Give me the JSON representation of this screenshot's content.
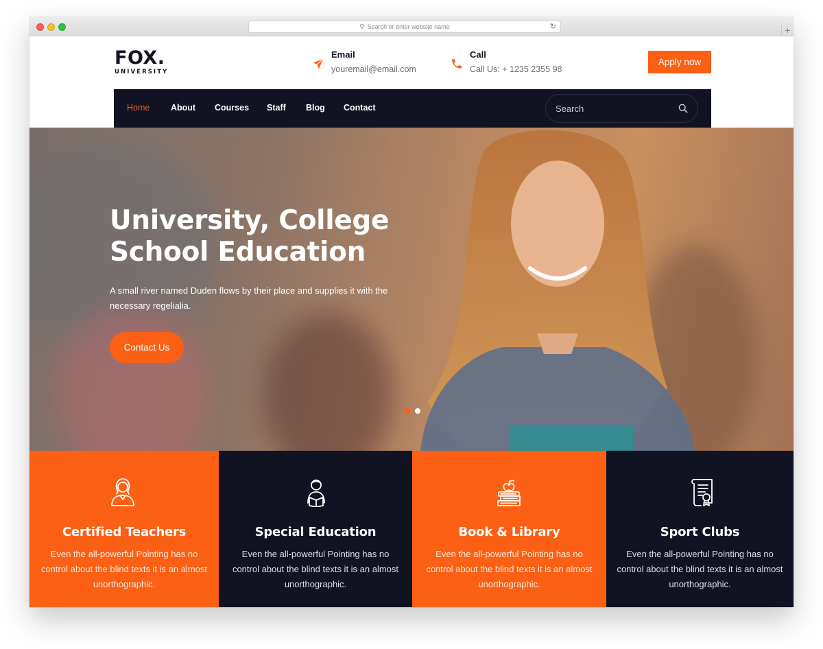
{
  "browser": {
    "address_placeholder": "Search or enter website name"
  },
  "header": {
    "logo_main": "FOX.",
    "logo_sub": "UNIVERSITY",
    "email": {
      "title": "Email",
      "value": "youremail@email.com",
      "icon": "paper-plane-icon"
    },
    "call": {
      "title": "Call",
      "value": "Call Us: + 1235 2355 98",
      "icon": "phone-icon"
    },
    "apply_label": "Apply now"
  },
  "nav": {
    "items": [
      {
        "label": "Home",
        "active": true
      },
      {
        "label": "About",
        "active": false
      },
      {
        "label": "Courses",
        "active": false
      },
      {
        "label": "Staff",
        "active": false
      },
      {
        "label": "Blog",
        "active": false
      },
      {
        "label": "Contact",
        "active": false
      }
    ],
    "search_placeholder": "Search",
    "search_icon": "search-icon"
  },
  "hero": {
    "title_line1": "University, College",
    "title_line2": "School Education",
    "subtitle": "A small river named Duden flows by their place and supplies it with the necessary regelialia.",
    "button_label": "Contact Us",
    "slides": 2,
    "active_slide": 1
  },
  "features": [
    {
      "title": "Certified Teachers",
      "description": "Even the all-powerful Pointing has no control about the blind texts it is an almost unorthographic.",
      "icon": "teacher-icon",
      "theme": "orange"
    },
    {
      "title": "Special Education",
      "description": "Even the all-powerful Pointing has no control about the blind texts it is an almost unorthographic.",
      "icon": "student-reading-icon",
      "theme": "dark"
    },
    {
      "title": "Book & Library",
      "description": "Even the all-powerful Pointing has no control about the blind texts it is an almost unorthographic.",
      "icon": "books-apple-icon",
      "theme": "orange"
    },
    {
      "title": "Sport Clubs",
      "description": "Even the all-powerful Pointing has no control about the blind texts it is an almost unorthographic.",
      "icon": "certificate-icon",
      "theme": "dark"
    }
  ],
  "colors": {
    "accent": "#fb6014",
    "dark": "#111322"
  }
}
